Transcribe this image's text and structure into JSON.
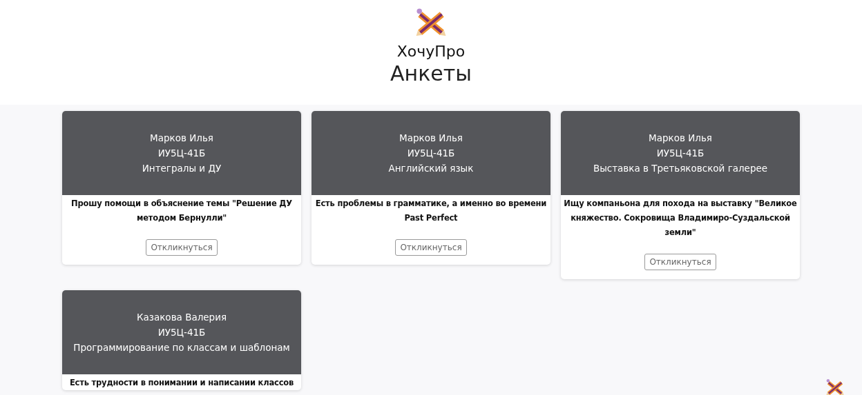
{
  "brand": {
    "name": "ХочуПро"
  },
  "page_title": "Анкеты",
  "cards": [
    {
      "name": "Марков Илья",
      "group": "ИУ5Ц-41Б",
      "topic": "Интегралы и ДУ",
      "description": "Прошу помощи в объяснение темы \"Решение ДУ методом Бернулли\"",
      "button": "Откликнуться"
    },
    {
      "name": "Марков Илья",
      "group": "ИУ5Ц-41Б",
      "topic": "Английский язык",
      "description": "Есть проблемы в грамматике, а именно во времени Past Perfect",
      "button": "Откликнуться"
    },
    {
      "name": "Марков Илья",
      "group": "ИУ5Ц-41Б",
      "topic": "Выставка в Третьяковской галерее",
      "description": "Ищу компаньона для похода на выставку \"Великое княжество. Сокровища Владимиро-Суздальской земли\"",
      "button": "Откликнуться"
    },
    {
      "name": "Казакова Валерия",
      "group": "ИУ5Ц-41Б",
      "topic": "Программирование по классам и шаблонам",
      "description": "Есть трудности в понимании и написании классов"
    }
  ]
}
